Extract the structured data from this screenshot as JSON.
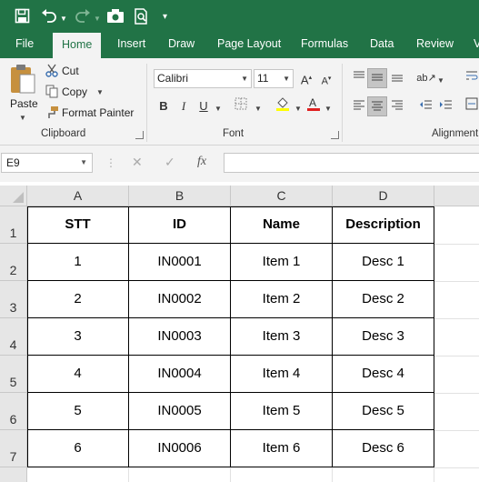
{
  "app": {
    "accent": "#217346"
  },
  "quick_access": [
    {
      "name": "save-icon",
      "glyph": "🖫"
    },
    {
      "name": "undo-icon",
      "glyph": "↶"
    },
    {
      "name": "redo-icon",
      "glyph": "↷"
    },
    {
      "name": "camera-icon",
      "glyph": "📷"
    },
    {
      "name": "print-preview-icon",
      "glyph": "🔍"
    },
    {
      "name": "customize-qat-icon",
      "glyph": "▾"
    }
  ],
  "tabs": [
    "File",
    "Home",
    "Insert",
    "Draw",
    "Page Layout",
    "Formulas",
    "Data",
    "Review",
    "V"
  ],
  "active_tab": "Home",
  "clipboard": {
    "paste": "Paste",
    "cut": "Cut",
    "copy": "Copy",
    "format_painter": "Format Painter",
    "group_label": "Clipboard"
  },
  "font": {
    "family": "Calibri",
    "size": "11",
    "bold": "B",
    "italic": "I",
    "underline": "U",
    "group_label": "Font"
  },
  "alignment": {
    "group_label": "Alignment"
  },
  "formula_bar": {
    "name_box": "E9",
    "cancel": "✕",
    "enter": "✓",
    "fx": "fx",
    "formula": ""
  },
  "sheet": {
    "columns": [
      "A",
      "B",
      "C",
      "D"
    ],
    "rows": [
      "1",
      "2",
      "3",
      "4",
      "5",
      "6",
      "7"
    ],
    "headers": [
      "STT",
      "ID",
      "Name",
      "Description"
    ],
    "data": [
      [
        "1",
        "IN0001",
        "Item 1",
        "Desc 1"
      ],
      [
        "2",
        "IN0002",
        "Item 2",
        "Desc 2"
      ],
      [
        "3",
        "IN0003",
        "Item 3",
        "Desc 3"
      ],
      [
        "4",
        "IN0004",
        "Item 4",
        "Desc 4"
      ],
      [
        "5",
        "IN0005",
        "Item 5",
        "Desc 5"
      ],
      [
        "6",
        "IN0006",
        "Item 6",
        "Desc 6"
      ]
    ]
  }
}
